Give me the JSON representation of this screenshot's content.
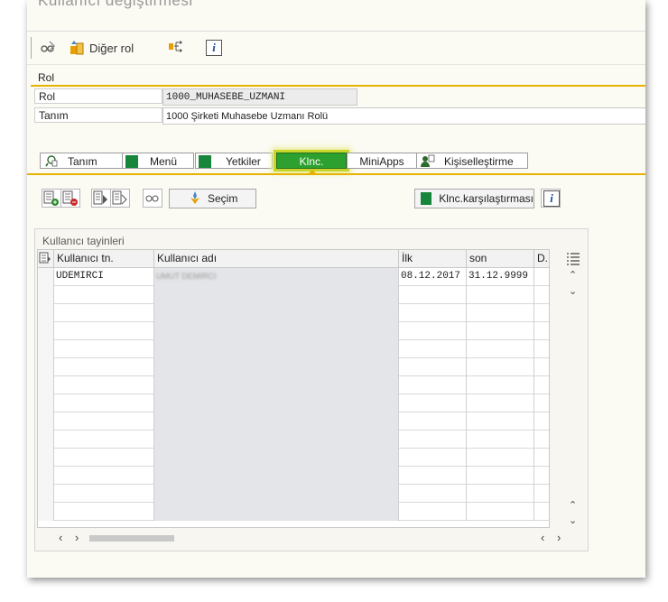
{
  "window": {
    "title_partial": "Kullanıcı değiştirmesi"
  },
  "toolbar": {
    "other_role_label": "Diğer rol"
  },
  "role": {
    "section_title": "Rol",
    "fields": [
      {
        "label": "Rol",
        "value": "1000_MUHASEBE_UZMANI"
      },
      {
        "label": "Tanım",
        "value": "1000 Şirketi Muhasebe Uzmanı Rolü"
      }
    ]
  },
  "tabs": [
    {
      "label": "Tanım",
      "icon": "description-icon"
    },
    {
      "label": "Menü",
      "icon": "green-square-icon"
    },
    {
      "label": "Yetkiler",
      "icon": "green-square-icon"
    },
    {
      "label": "Klnc.",
      "active": true
    },
    {
      "label": "MiniApps"
    },
    {
      "label": "Kişiselleştirme",
      "icon": "person-settings-icon"
    }
  ],
  "actions": {
    "selection_label": "Seçim",
    "compare_label": "Klnc.karşılaştırması"
  },
  "assignments": {
    "panel_title": "Kullanıcı tayinleri",
    "columns": [
      "Kullanıcı tn.",
      "Kullanıcı adı",
      "İlk",
      "son",
      "D.."
    ],
    "rows": [
      {
        "user_id": "UDEMIRCI",
        "user_name": "UMUT DEMIRCI",
        "from": "08.12.2017",
        "to": "31.12.9999",
        "d": ""
      }
    ],
    "empty_rows": 13
  },
  "colors": {
    "accent_yellow": "#e8b200",
    "active_tab_green": "#2da12f",
    "square_green": "#17853a"
  }
}
